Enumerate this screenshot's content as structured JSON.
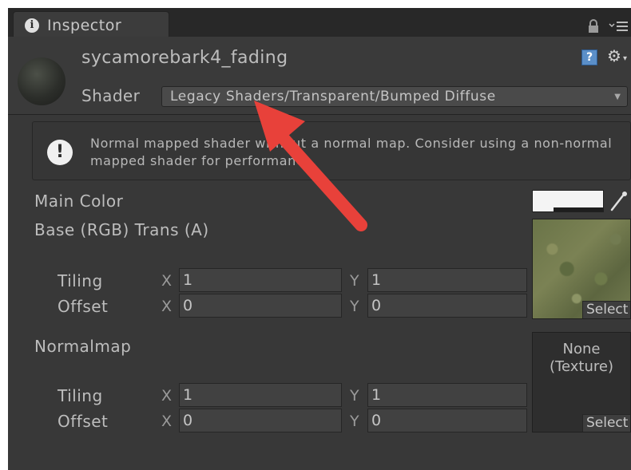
{
  "tab": {
    "label": "Inspector"
  },
  "material": {
    "name": "sycamorebark4_fading"
  },
  "shader": {
    "label": "Shader",
    "value": "Legacy Shaders/Transparent/Bumped Diffuse"
  },
  "warning": {
    "text": "Normal mapped shader without a normal map. Consider using a non-normal mapped shader for performance."
  },
  "properties": {
    "main_color": {
      "label": "Main Color",
      "color": "#f4f4f4"
    },
    "base": {
      "label": "Base (RGB) Trans (A)",
      "tiling_label": "Tiling",
      "offset_label": "Offset",
      "tiling": {
        "x_label": "X",
        "x": "1",
        "y_label": "Y",
        "y": "1"
      },
      "offset": {
        "x_label": "X",
        "x": "0",
        "y_label": "Y",
        "y": "0"
      },
      "select_label": "Select"
    },
    "normalmap": {
      "label": "Normalmap",
      "none_text_1": "None",
      "none_text_2": "(Texture)",
      "tiling_label": "Tiling",
      "offset_label": "Offset",
      "tiling": {
        "x_label": "X",
        "x": "1",
        "y_label": "Y",
        "y": "1"
      },
      "offset": {
        "x_label": "X",
        "x": "0",
        "y_label": "Y",
        "y": "0"
      },
      "select_label": "Select"
    }
  },
  "colors": {
    "panel": "#383838",
    "annotation_arrow": "#e8413a"
  }
}
